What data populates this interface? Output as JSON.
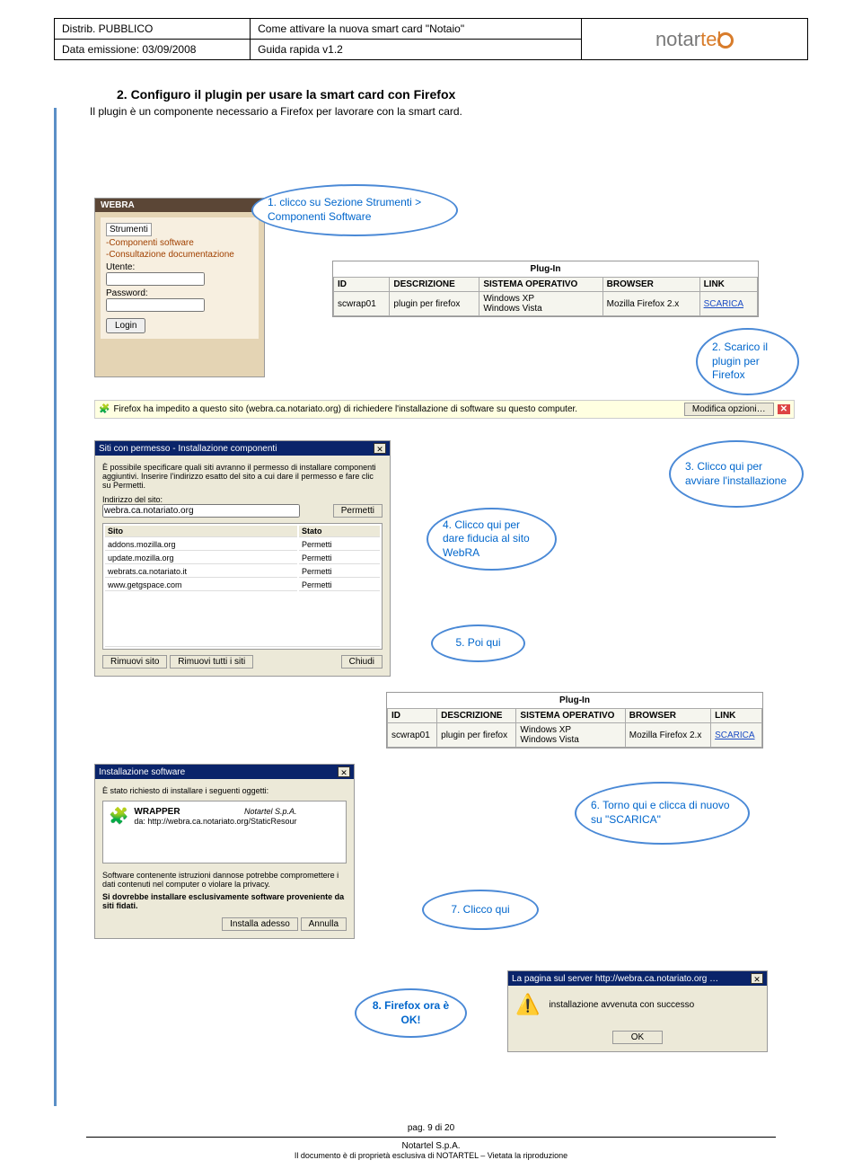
{
  "header": {
    "left_top": "Distrib. PUBBLICO",
    "left_bottom": "Data emissione: 03/09/2008",
    "mid_top": "Come attivare la nuova smart card \"Notaio\"",
    "mid_bottom": "Guida rapida v1.2",
    "logo_prefix": "notar",
    "logo_suffix": "tel"
  },
  "section": {
    "number_title": "2. Configuro il plugin per usare la smart card con Firefox",
    "intro": "Il plugin è un componente necessario a Firefox per lavorare con la smart card."
  },
  "callouts": {
    "c1": "1. clicco su Sezione Strumenti > Componenti Software",
    "c2": "2. Scarico il plugin per Firefox",
    "c3": "3. Clicco qui per avviare l'installazione",
    "c4": "4. Clicco qui per dare fiducia al sito WebRA",
    "c5": "5. Poi qui",
    "c6": "6. Torno qui e clicca di nuovo su \"SCARICA\"",
    "c7": "7. Clicco qui",
    "c8": "8. Firefox ora è OK!"
  },
  "login": {
    "top_bar": "WEBRA",
    "menu_title": "Strumenti",
    "link1": "-Componenti software",
    "link2": "-Consultazione documentazione",
    "user_label": "Utente:",
    "pwd_label": "Password:",
    "login_btn": "Login"
  },
  "plugin_table": {
    "caption": "Plug-In",
    "headers": [
      "ID",
      "DESCRIZIONE",
      "SISTEMA OPERATIVO",
      "BROWSER",
      "LINK"
    ],
    "row": {
      "id": "scwrap01",
      "desc": "plugin per firefox",
      "os": "Windows XP\nWindows Vista",
      "browser": "Mozilla Firefox 2.x",
      "link": "SCARICA"
    }
  },
  "infobar": {
    "icon_label": "🧩",
    "text": "Firefox ha impedito a questo sito (webra.ca.notariato.org) di richiedere l'installazione di software su questo computer.",
    "btn": "Modifica opzioni…",
    "close": "✕"
  },
  "perm_dialog": {
    "title": "Siti con permesso - Installazione componenti",
    "desc": "È possibile specificare quali siti avranno il permesso di installare componenti aggiuntivi. Inserire l'indirizzo esatto del sito a cui dare il permesso e fare clic su Permetti.",
    "addr_label": "Indirizzo del sito:",
    "addr_value": "webra.ca.notariato.org",
    "permetti_btn": "Permetti",
    "col_site": "Sito",
    "col_status": "Stato",
    "rows": [
      {
        "site": "addons.mozilla.org",
        "status": "Permetti"
      },
      {
        "site": "update.mozilla.org",
        "status": "Permetti"
      },
      {
        "site": "webrats.ca.notariato.it",
        "status": "Permetti"
      },
      {
        "site": "www.getgspace.com",
        "status": "Permetti"
      }
    ],
    "rimuovi": "Rimuovi sito",
    "rimuovi_tutti": "Rimuovi tutti i siti",
    "chiudi": "Chiudi"
  },
  "install_dialog": {
    "title": "Installazione software",
    "line1": "È stato richiesto di installare i seguenti oggetti:",
    "item_name": "WRAPPER",
    "item_vendor": "Notartel S.p.A.",
    "item_src_label": "da:",
    "item_src": "http://webra.ca.notariato.org/StaticResour",
    "warn1": "Software contenente istruzioni dannose potrebbe compromettere i dati contenuti nel computer o violare la privacy.",
    "warn2": "Si dovrebbe installare esclusivamente software proveniente da siti fidati.",
    "install_btn": "Installa adesso",
    "cancel_btn": "Annulla"
  },
  "ok_dialog": {
    "title": "La pagina sul server http://webra.ca.notariato.org …",
    "msg": "installazione avvenuta con successo",
    "ok_btn": "OK"
  },
  "footer": {
    "page": "pag. 9 di 20",
    "company": "Notartel S.p.A.",
    "rights": "Il documento è di proprietà esclusiva di NOTARTEL – Vietata la riproduzione"
  }
}
